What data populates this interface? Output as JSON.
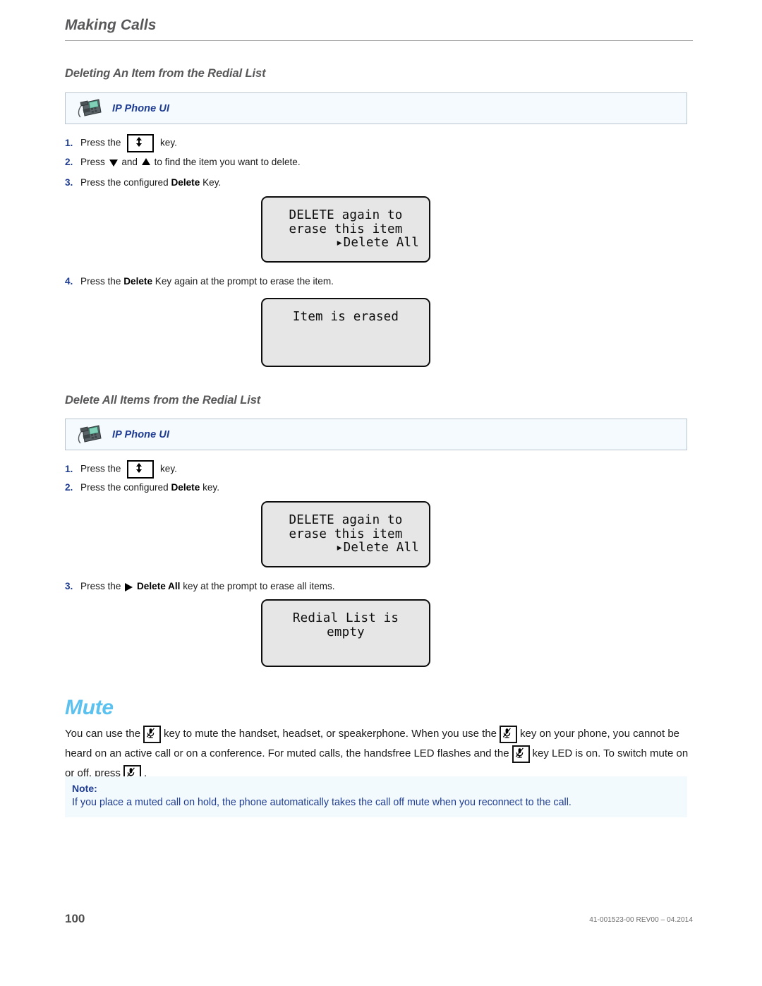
{
  "header": {
    "running_title": "Making Calls"
  },
  "sections": {
    "delete_item": {
      "heading": "Deleting An Item from the Redial List",
      "callout_label": "IP Phone UI",
      "steps": [
        {
          "num": "1.",
          "pre": "Press the",
          "key": "updown-arrow-key",
          "post": "key."
        },
        {
          "num": "2.",
          "pre": "Press",
          "post": "to find the item you want to delete.",
          "mid": "and"
        },
        {
          "num": "3.",
          "pre": "Press the configured",
          "bold": "Delete",
          "post": "Key."
        },
        {
          "num": "4.",
          "pre": "Press the",
          "bold": "Delete",
          "post": "Key again at the prompt to erase the item."
        }
      ],
      "lcd_prompt": {
        "line1": "DELETE again to",
        "line2": "erase this item",
        "line3": "Delete All",
        "line3_marker": "▸"
      },
      "lcd_result": {
        "line1": "Item is erased"
      }
    },
    "delete_all": {
      "heading": "Delete All Items from the Redial List",
      "callout_label": "IP Phone UI",
      "steps": [
        {
          "num": "1.",
          "pre": "Press the",
          "key": "updown-arrow-key",
          "post": "key."
        },
        {
          "num": "2.",
          "pre": "Press the configured",
          "bold": "Delete",
          "post": "key."
        },
        {
          "num": "3.",
          "pre": "Press the",
          "bold": "Delete All",
          "post": "key at the prompt to erase all items."
        }
      ],
      "lcd_prompt": {
        "line1": "DELETE again to",
        "line2": "erase this item",
        "line3": "Delete All",
        "line3_marker": "▸"
      },
      "lcd_result": {
        "line1": "Redial List is",
        "line2": "empty"
      }
    },
    "mute": {
      "heading": "Mute",
      "para_part1": "You can use the",
      "para_part2": "key to mute the handset, headset, or speakerphone. When you use the",
      "para_part3": "key on your phone, you cannot be heard on an active call or on a conference. For muted calls, the handsfree LED flashes and the",
      "para_part4": "key LED is on. To switch mute on or off, press",
      "para_part5": ".",
      "note": {
        "title": "Note:",
        "body": "If you place a muted call on hold, the phone automatically takes the call off mute when you reconnect to the call."
      }
    }
  },
  "footer": {
    "page_number": "100",
    "document_ref": "41-001523-00 REV00 – 04.2014"
  },
  "icons": {
    "phone": "desk-phone-icon",
    "updown": "updown-arrow-icon",
    "mute": "mute-microphone-icon",
    "triangle_down": "triangle-down-icon",
    "triangle_up": "triangle-up-icon",
    "triangle_right": "triangle-right-icon"
  },
  "colors": {
    "accent_blue": "#1f3c93",
    "chapter_blue": "#5bc2f0",
    "heading_gray": "#58585a",
    "callout_bg": "#f4fafd",
    "note_bg": "#f2fafd",
    "lcd_bg": "#e6e6e6"
  }
}
